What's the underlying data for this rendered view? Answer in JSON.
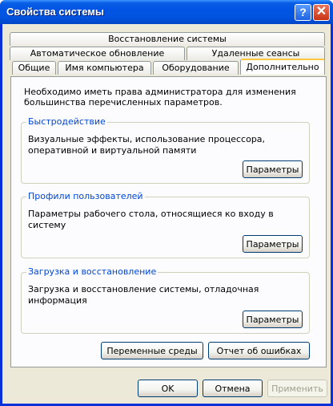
{
  "window": {
    "title": "Свойства системы",
    "help_glyph": "?",
    "close_glyph": "✕"
  },
  "tabs": {
    "row1": [
      "Восстановление системы"
    ],
    "row2": [
      "Автоматическое обновление",
      "Удаленные сеансы"
    ],
    "row3": [
      "Общие",
      "Имя компьютера",
      "Оборудование",
      "Дополнительно"
    ],
    "active": "Дополнительно"
  },
  "panel": {
    "intro": "Необходимо иметь права администратора для изменения большинства перечисленных параметров.",
    "performance": {
      "label": "Быстродействие",
      "text": "Визуальные эффекты, использование процессора, оперативной и виртуальной памяти",
      "button": "Параметры"
    },
    "profiles": {
      "label": "Профили пользователей",
      "text": "Параметры рабочего стола, относящиеся ко входу в систему",
      "button": "Параметры"
    },
    "startup": {
      "label": "Загрузка и восстановление",
      "text": "Загрузка и восстановление системы, отладочная информация",
      "button": "Параметры"
    },
    "env_button": "Переменные среды",
    "error_button": "Отчет об ошибках"
  },
  "footer": {
    "ok": "OK",
    "cancel": "Отмена",
    "apply": "Применить"
  },
  "colors": {
    "titlebar": "#0054e3",
    "dialog_bg": "#ece9d8",
    "group_label": "#0046d5",
    "active_tab_accent": "#ffc83c"
  }
}
